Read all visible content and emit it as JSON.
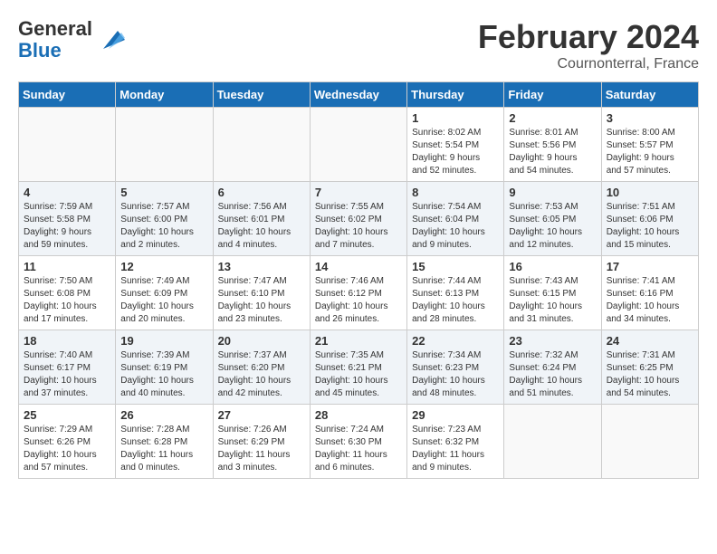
{
  "header": {
    "logo_line1": "General",
    "logo_line2": "Blue",
    "month": "February 2024",
    "location": "Cournonterral, France"
  },
  "weekdays": [
    "Sunday",
    "Monday",
    "Tuesday",
    "Wednesday",
    "Thursday",
    "Friday",
    "Saturday"
  ],
  "weeks": [
    [
      {
        "day": "",
        "info": ""
      },
      {
        "day": "",
        "info": ""
      },
      {
        "day": "",
        "info": ""
      },
      {
        "day": "",
        "info": ""
      },
      {
        "day": "1",
        "info": "Sunrise: 8:02 AM\nSunset: 5:54 PM\nDaylight: 9 hours\nand 52 minutes."
      },
      {
        "day": "2",
        "info": "Sunrise: 8:01 AM\nSunset: 5:56 PM\nDaylight: 9 hours\nand 54 minutes."
      },
      {
        "day": "3",
        "info": "Sunrise: 8:00 AM\nSunset: 5:57 PM\nDaylight: 9 hours\nand 57 minutes."
      }
    ],
    [
      {
        "day": "4",
        "info": "Sunrise: 7:59 AM\nSunset: 5:58 PM\nDaylight: 9 hours\nand 59 minutes."
      },
      {
        "day": "5",
        "info": "Sunrise: 7:57 AM\nSunset: 6:00 PM\nDaylight: 10 hours\nand 2 minutes."
      },
      {
        "day": "6",
        "info": "Sunrise: 7:56 AM\nSunset: 6:01 PM\nDaylight: 10 hours\nand 4 minutes."
      },
      {
        "day": "7",
        "info": "Sunrise: 7:55 AM\nSunset: 6:02 PM\nDaylight: 10 hours\nand 7 minutes."
      },
      {
        "day": "8",
        "info": "Sunrise: 7:54 AM\nSunset: 6:04 PM\nDaylight: 10 hours\nand 9 minutes."
      },
      {
        "day": "9",
        "info": "Sunrise: 7:53 AM\nSunset: 6:05 PM\nDaylight: 10 hours\nand 12 minutes."
      },
      {
        "day": "10",
        "info": "Sunrise: 7:51 AM\nSunset: 6:06 PM\nDaylight: 10 hours\nand 15 minutes."
      }
    ],
    [
      {
        "day": "11",
        "info": "Sunrise: 7:50 AM\nSunset: 6:08 PM\nDaylight: 10 hours\nand 17 minutes."
      },
      {
        "day": "12",
        "info": "Sunrise: 7:49 AM\nSunset: 6:09 PM\nDaylight: 10 hours\nand 20 minutes."
      },
      {
        "day": "13",
        "info": "Sunrise: 7:47 AM\nSunset: 6:10 PM\nDaylight: 10 hours\nand 23 minutes."
      },
      {
        "day": "14",
        "info": "Sunrise: 7:46 AM\nSunset: 6:12 PM\nDaylight: 10 hours\nand 26 minutes."
      },
      {
        "day": "15",
        "info": "Sunrise: 7:44 AM\nSunset: 6:13 PM\nDaylight: 10 hours\nand 28 minutes."
      },
      {
        "day": "16",
        "info": "Sunrise: 7:43 AM\nSunset: 6:15 PM\nDaylight: 10 hours\nand 31 minutes."
      },
      {
        "day": "17",
        "info": "Sunrise: 7:41 AM\nSunset: 6:16 PM\nDaylight: 10 hours\nand 34 minutes."
      }
    ],
    [
      {
        "day": "18",
        "info": "Sunrise: 7:40 AM\nSunset: 6:17 PM\nDaylight: 10 hours\nand 37 minutes."
      },
      {
        "day": "19",
        "info": "Sunrise: 7:39 AM\nSunset: 6:19 PM\nDaylight: 10 hours\nand 40 minutes."
      },
      {
        "day": "20",
        "info": "Sunrise: 7:37 AM\nSunset: 6:20 PM\nDaylight: 10 hours\nand 42 minutes."
      },
      {
        "day": "21",
        "info": "Sunrise: 7:35 AM\nSunset: 6:21 PM\nDaylight: 10 hours\nand 45 minutes."
      },
      {
        "day": "22",
        "info": "Sunrise: 7:34 AM\nSunset: 6:23 PM\nDaylight: 10 hours\nand 48 minutes."
      },
      {
        "day": "23",
        "info": "Sunrise: 7:32 AM\nSunset: 6:24 PM\nDaylight: 10 hours\nand 51 minutes."
      },
      {
        "day": "24",
        "info": "Sunrise: 7:31 AM\nSunset: 6:25 PM\nDaylight: 10 hours\nand 54 minutes."
      }
    ],
    [
      {
        "day": "25",
        "info": "Sunrise: 7:29 AM\nSunset: 6:26 PM\nDaylight: 10 hours\nand 57 minutes."
      },
      {
        "day": "26",
        "info": "Sunrise: 7:28 AM\nSunset: 6:28 PM\nDaylight: 11 hours\nand 0 minutes."
      },
      {
        "day": "27",
        "info": "Sunrise: 7:26 AM\nSunset: 6:29 PM\nDaylight: 11 hours\nand 3 minutes."
      },
      {
        "day": "28",
        "info": "Sunrise: 7:24 AM\nSunset: 6:30 PM\nDaylight: 11 hours\nand 6 minutes."
      },
      {
        "day": "29",
        "info": "Sunrise: 7:23 AM\nSunset: 6:32 PM\nDaylight: 11 hours\nand 9 minutes."
      },
      {
        "day": "",
        "info": ""
      },
      {
        "day": "",
        "info": ""
      }
    ]
  ]
}
